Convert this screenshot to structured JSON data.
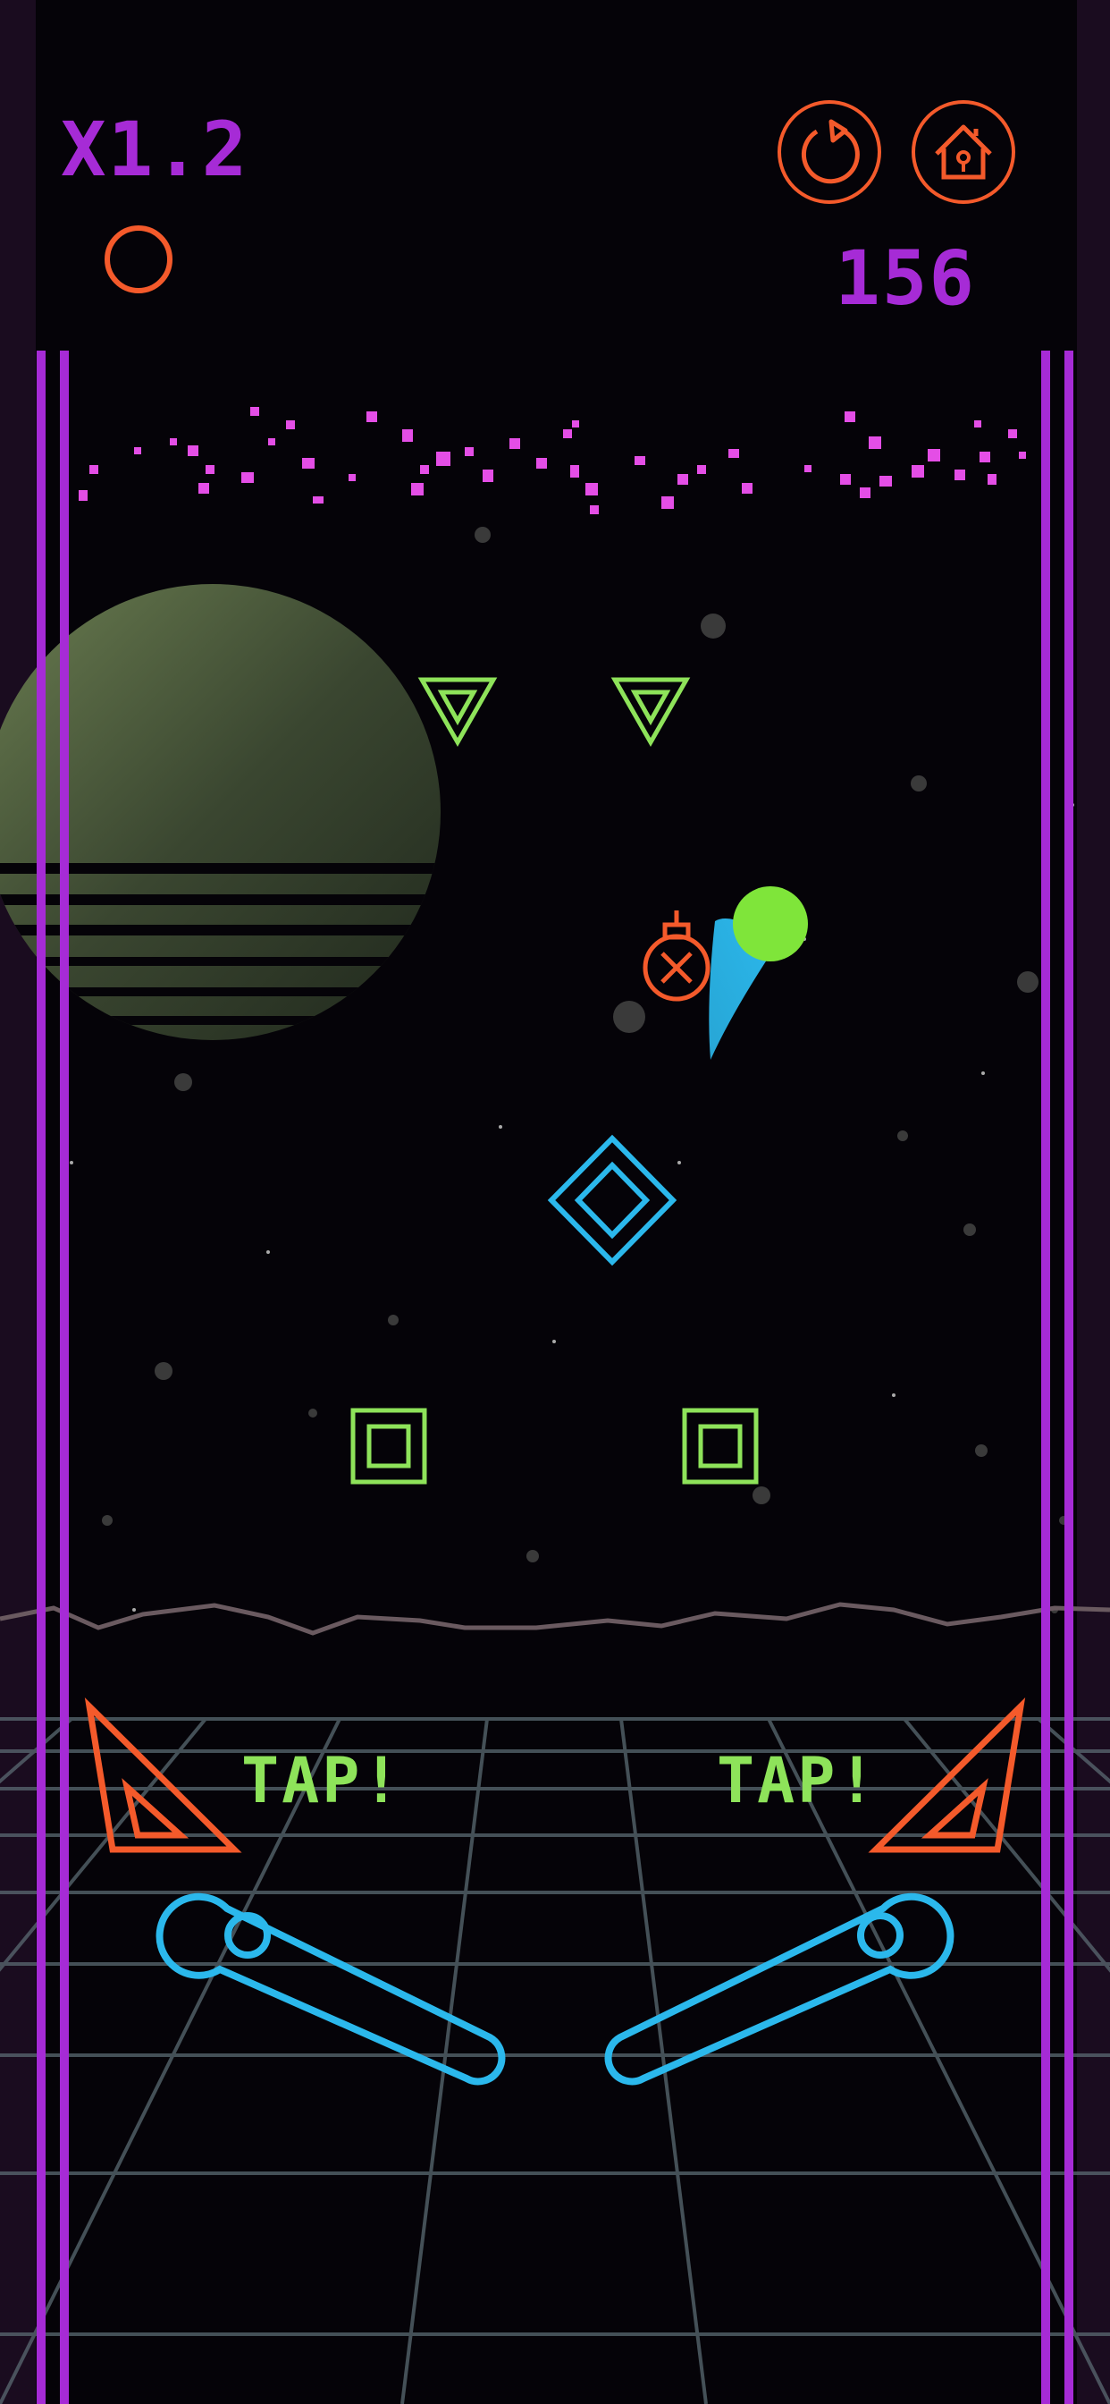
{
  "hud": {
    "multiplier": "X1.2",
    "score": "156"
  },
  "buttons": {
    "restart_icon": "restart-icon",
    "home_icon": "home-icon"
  },
  "prompts": {
    "left_tap": "TAP!",
    "right_tap": "TAP!"
  },
  "colors": {
    "purple": "#a62bd6",
    "orange": "#f45a2b",
    "green": "#8ee35a",
    "cyan": "#2bb8ec",
    "magenta": "#e44ee6",
    "planet": "#4b5a3c"
  }
}
